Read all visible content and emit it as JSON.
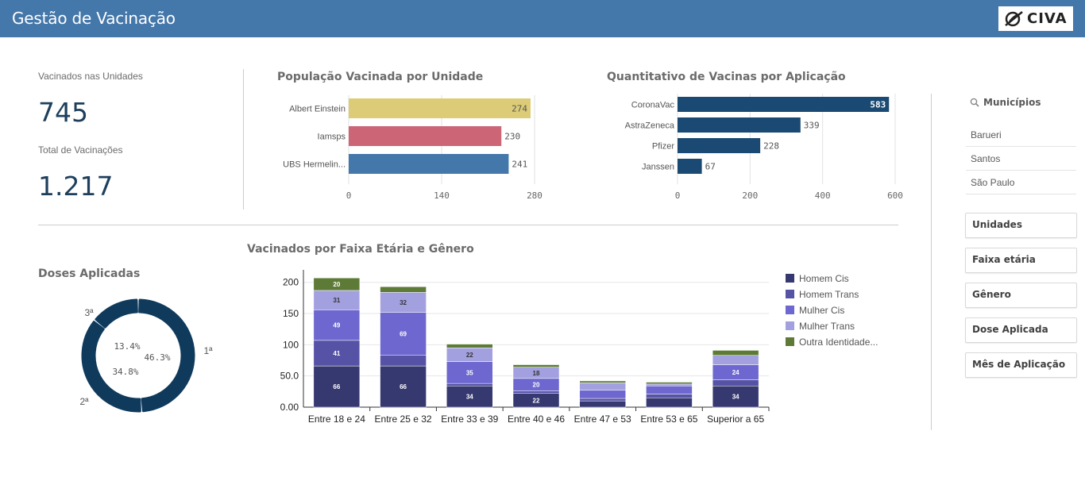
{
  "header": {
    "title": "Gestão de Vacinação",
    "logo_text": "CIVA"
  },
  "kpis": {
    "vaccinated_label": "Vacinados nas Unidades",
    "vaccinated_value": "745",
    "total_label": "Total de Vacinações",
    "total_value": "1.217"
  },
  "filters": {
    "title": "Municípios",
    "items": [
      "Barueri",
      "Santos",
      "São Paulo"
    ],
    "buttons": [
      "Unidades",
      "Faixa etária",
      "Gênero",
      "Dose Aplicada",
      "Mês de Aplicação"
    ]
  },
  "chart_data": [
    {
      "id": "unidades",
      "type": "bar",
      "orientation": "horizontal",
      "title": "População Vacinada por Unidade",
      "categories": [
        "Albert Einstein",
        "Iamsps",
        "UBS Hermelin..."
      ],
      "values": [
        274,
        230,
        241
      ],
      "colors": [
        "#ddcc77",
        "#cc6677",
        "#4477aa"
      ],
      "xlim": [
        0,
        280
      ],
      "xticks": [
        "0",
        "140",
        "280"
      ],
      "grid": true
    },
    {
      "id": "vacinas",
      "type": "bar",
      "orientation": "horizontal",
      "title": "Quantitativo de Vacinas por Aplicação",
      "categories": [
        "CoronaVac",
        "AstraZeneca",
        "Pfizer",
        "Janssen"
      ],
      "values": [
        583,
        339,
        228,
        67
      ],
      "color": "#1a4a73",
      "xlim": [
        0,
        600
      ],
      "xticks": [
        "0",
        "200",
        "400",
        "600"
      ],
      "grid": true
    },
    {
      "id": "doses",
      "type": "pie",
      "variant": "donut",
      "title": "Doses Aplicadas",
      "categories": [
        "1ª",
        "2ª",
        "3ª"
      ],
      "labels": [
        "46.3%",
        "34.8%",
        "13.4%"
      ],
      "values": [
        46.3,
        34.8,
        13.4
      ],
      "color": "#0f3a5c"
    },
    {
      "id": "faixa",
      "type": "bar",
      "stacked": true,
      "title": "Vacinados por Faixa Etária e Gênero",
      "categories": [
        "Entre 18 e 24",
        "Entre 25 e 32",
        "Entre 33 e 39",
        "Entre 40 e 46",
        "Entre 47 e 53",
        "Entre 53 e 65",
        "Superior a 65"
      ],
      "ylim": [
        0,
        220
      ],
      "yticks": [
        "0.00",
        "50.0",
        "100",
        "150",
        "200"
      ],
      "legend_position": "right",
      "series": [
        {
          "name": "Homem Cis",
          "color": "#363870",
          "values": [
            66,
            66,
            34,
            22,
            10,
            15,
            34
          ]
        },
        {
          "name": "Homem Trans",
          "color": "#5652a6",
          "values": [
            41,
            17,
            4,
            4,
            4,
            6,
            10
          ]
        },
        {
          "name": "Mulher Cis",
          "color": "#6d67cf",
          "values": [
            49,
            69,
            35,
            20,
            13,
            13,
            24
          ]
        },
        {
          "name": "Mulher Trans",
          "color": "#a3a0e0",
          "values": [
            31,
            32,
            22,
            18,
            12,
            3,
            15
          ]
        },
        {
          "name": "Outra Identidade...",
          "color": "#5d7b36",
          "values": [
            20,
            9,
            6,
            4,
            3,
            3,
            8
          ]
        }
      ],
      "data_labels": [
        {
          "category": 0,
          "series": 0,
          "text": "66"
        },
        {
          "category": 0,
          "series": 1,
          "text": "41"
        },
        {
          "category": 0,
          "series": 2,
          "text": "49"
        },
        {
          "category": 0,
          "series": 3,
          "text": "31"
        },
        {
          "category": 0,
          "series": 4,
          "text": "20"
        },
        {
          "category": 1,
          "series": 0,
          "text": "66"
        },
        {
          "category": 1,
          "series": 2,
          "text": "69"
        },
        {
          "category": 1,
          "series": 3,
          "text": "32"
        },
        {
          "category": 2,
          "series": 0,
          "text": "34"
        },
        {
          "category": 2,
          "series": 2,
          "text": "35"
        },
        {
          "category": 2,
          "series": 3,
          "text": "22"
        },
        {
          "category": 3,
          "series": 0,
          "text": "22"
        },
        {
          "category": 3,
          "series": 2,
          "text": "20"
        },
        {
          "category": 3,
          "series": 3,
          "text": "18"
        },
        {
          "category": 6,
          "series": 0,
          "text": "34"
        },
        {
          "category": 6,
          "series": 2,
          "text": "24"
        }
      ]
    }
  ]
}
